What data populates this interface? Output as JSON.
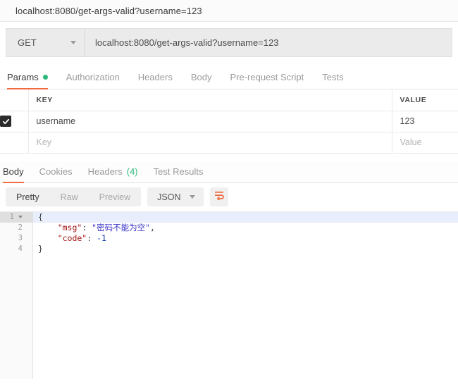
{
  "titlebar": {
    "url": "localhost:8080/get-args-valid?username=123"
  },
  "request": {
    "method": "GET",
    "method_caret_icon": "chevron-down-icon",
    "url_value": "localhost:8080/get-args-valid?username=123",
    "url_placeholder": "Enter request URL"
  },
  "request_tabs": [
    {
      "label": "Params",
      "active": true,
      "dot": true
    },
    {
      "label": "Authorization",
      "active": false,
      "dot": false
    },
    {
      "label": "Headers",
      "active": false,
      "dot": false
    },
    {
      "label": "Body",
      "active": false,
      "dot": false
    },
    {
      "label": "Pre-request Script",
      "active": false,
      "dot": false
    },
    {
      "label": "Tests",
      "active": false,
      "dot": false
    }
  ],
  "params": {
    "columns": {
      "key": "KEY",
      "value": "VALUE"
    },
    "rows": [
      {
        "checked": true,
        "key": "username",
        "value": "123",
        "placeholder": false
      },
      {
        "checked": false,
        "key": "Key",
        "value": "Value",
        "placeholder": true
      }
    ]
  },
  "response_tabs": [
    {
      "label": "Body",
      "count": "",
      "active": true
    },
    {
      "label": "Cookies",
      "count": "",
      "active": false
    },
    {
      "label": "Headers",
      "count": "(4)",
      "active": false
    },
    {
      "label": "Test Results",
      "count": "",
      "active": false
    }
  ],
  "response_toolbar": {
    "view_modes": [
      {
        "label": "Pretty",
        "active": true
      },
      {
        "label": "Raw",
        "active": false
      },
      {
        "label": "Preview",
        "active": false
      }
    ],
    "format": "JSON",
    "format_caret_icon": "chevron-down-icon",
    "wrap_icon": "word-wrap-icon"
  },
  "response_body": {
    "lines": [
      {
        "no": "1",
        "foldable": true,
        "active": true,
        "tokens": [
          {
            "t": "{",
            "c": "punc"
          }
        ]
      },
      {
        "no": "2",
        "foldable": false,
        "active": false,
        "tokens": [
          {
            "t": "    \"msg\"",
            "c": "key"
          },
          {
            "t": ": ",
            "c": "punc"
          },
          {
            "t": "\"密码不能为空\"",
            "c": "str"
          },
          {
            "t": ",",
            "c": "punc"
          }
        ]
      },
      {
        "no": "3",
        "foldable": false,
        "active": false,
        "tokens": [
          {
            "t": "    \"code\"",
            "c": "key"
          },
          {
            "t": ": ",
            "c": "punc"
          },
          {
            "t": "-1",
            "c": "num"
          }
        ]
      },
      {
        "no": "4",
        "foldable": false,
        "active": false,
        "tokens": [
          {
            "t": "}",
            "c": "punc"
          }
        ]
      }
    ]
  },
  "colors": {
    "accent_orange": "#ef6c3e",
    "status_green": "#2db97c",
    "json_key": "#a31515",
    "json_string": "#3a32c8",
    "json_number": "#1b3fb5"
  }
}
